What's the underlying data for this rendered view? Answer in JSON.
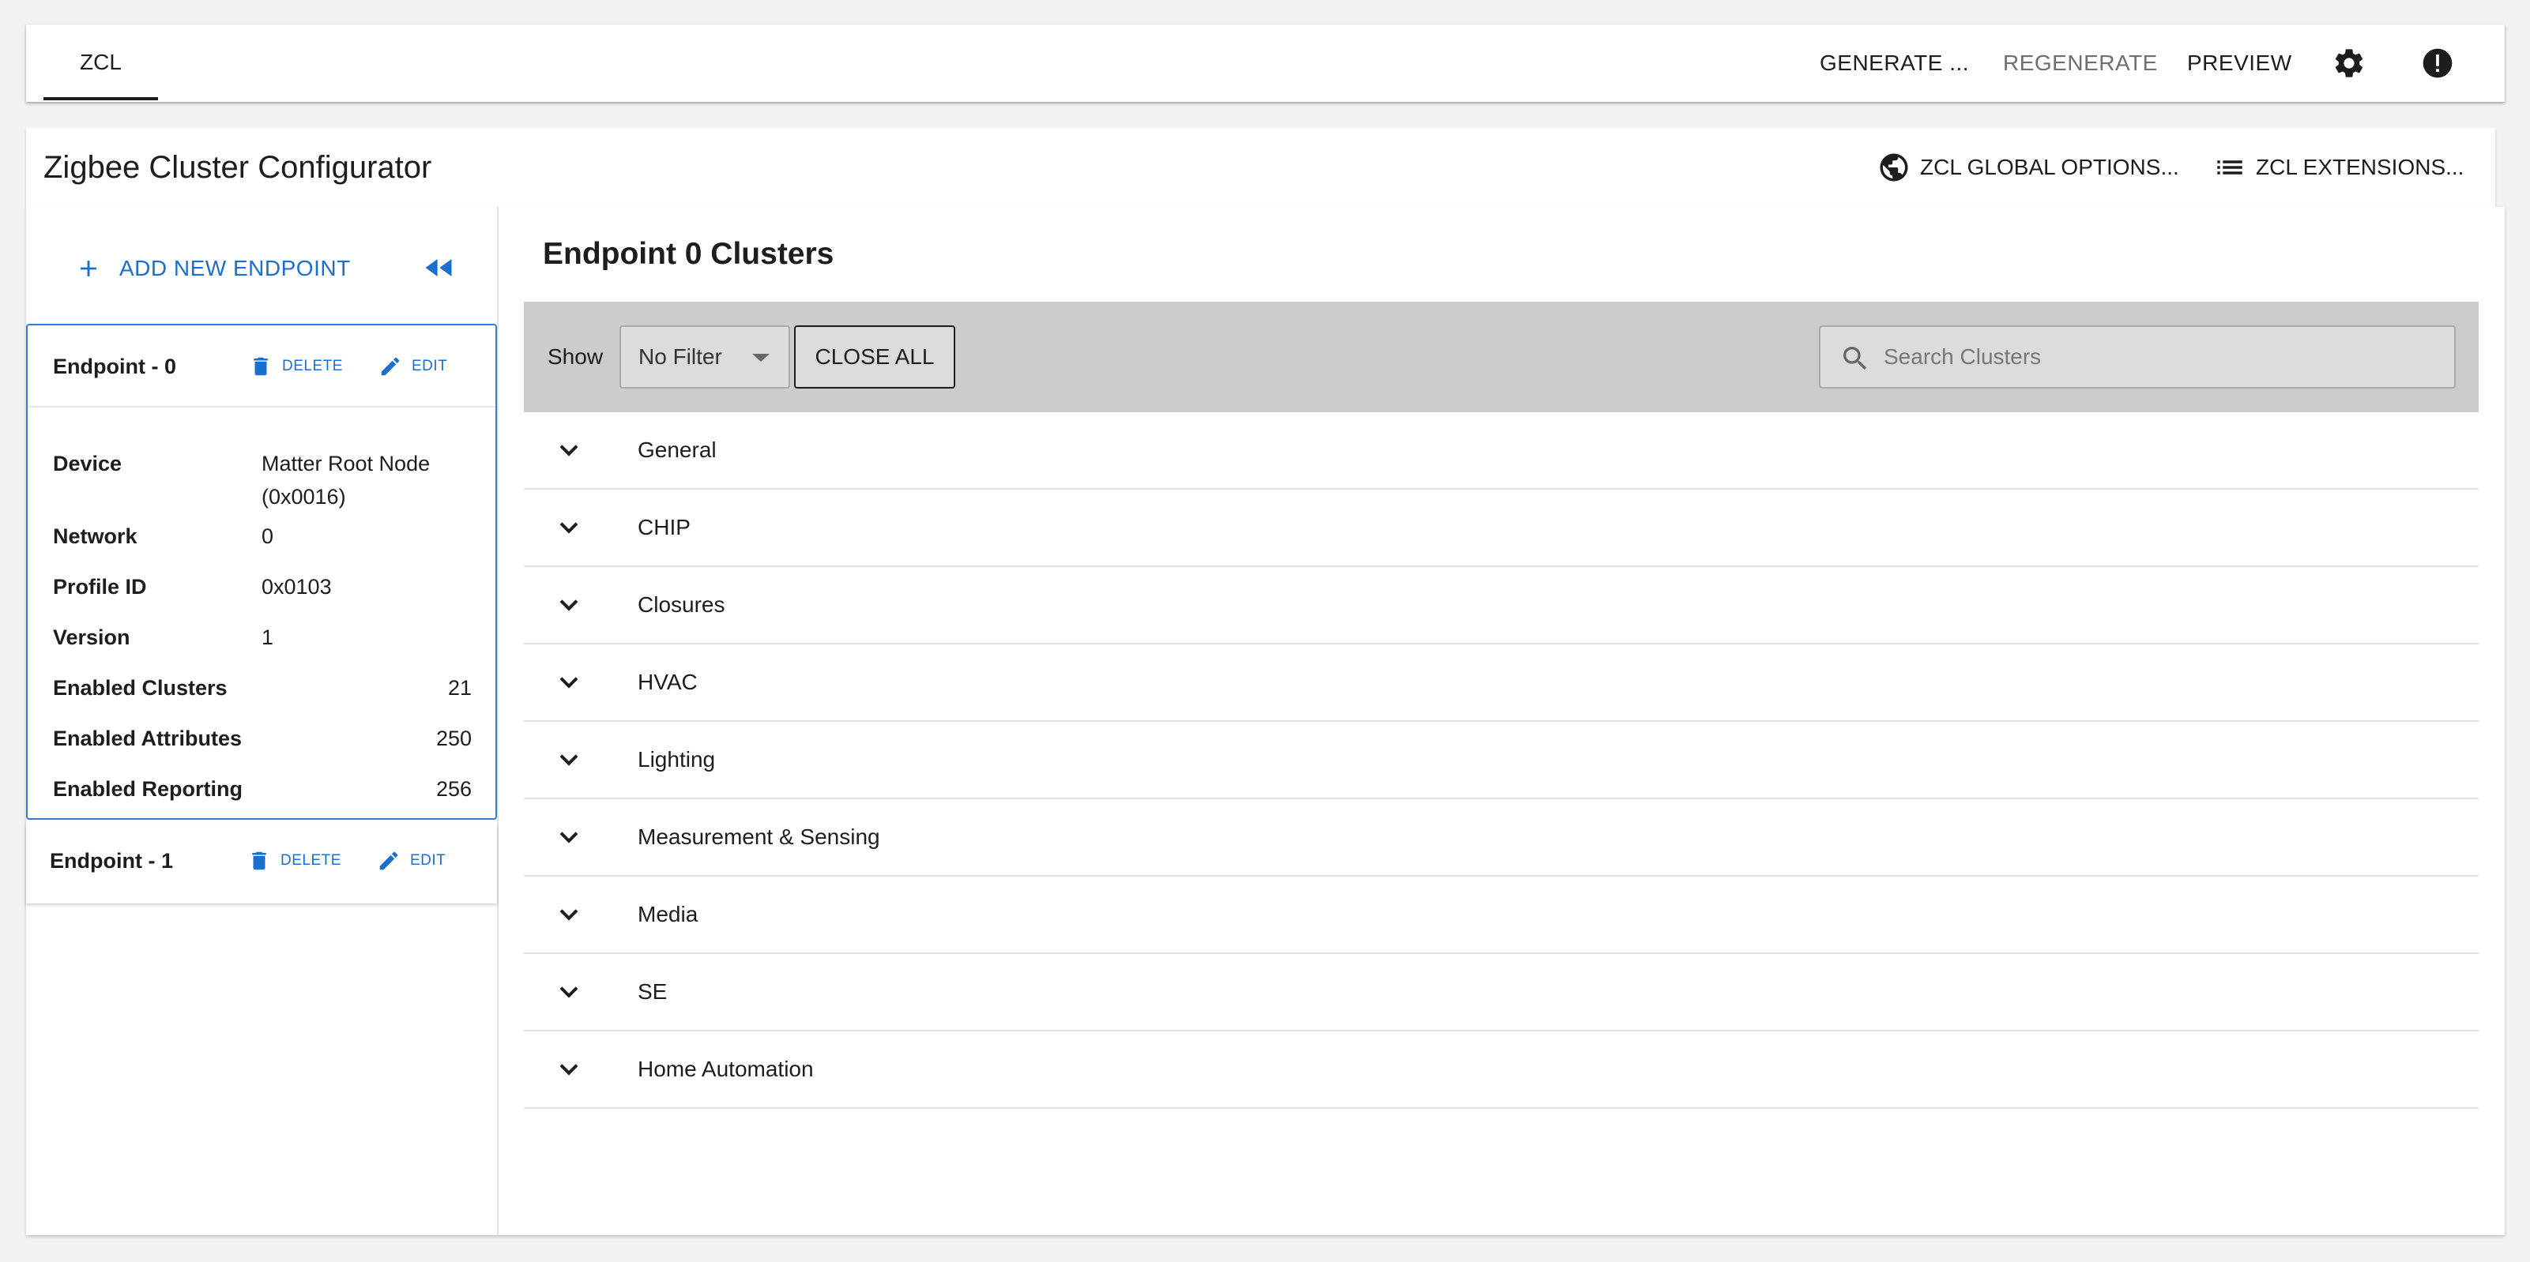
{
  "toolbar": {
    "tab_label": "ZCL",
    "generate_label": "GENERATE ...",
    "regenerate_label": "REGENERATE",
    "preview_label": "PREVIEW"
  },
  "header": {
    "title": "Zigbee Cluster Configurator",
    "global_options_label": "ZCL GLOBAL OPTIONS...",
    "extensions_label": "ZCL EXTENSIONS..."
  },
  "sidebar": {
    "add_endpoint_label": "ADD NEW ENDPOINT",
    "endpoints": [
      {
        "name": "Endpoint - 0",
        "delete_label": "DELETE",
        "edit_label": "EDIT",
        "device_label": "Device",
        "device_value_line1": "Matter Root Node",
        "device_value_line2": "(0x0016)",
        "network_label": "Network",
        "network_value": "0",
        "profile_label": "Profile ID",
        "profile_value": "0x0103",
        "version_label": "Version",
        "version_value": "1",
        "enabled_clusters_label": "Enabled Clusters",
        "enabled_clusters_value": "21",
        "enabled_attributes_label": "Enabled Attributes",
        "enabled_attributes_value": "250",
        "enabled_reporting_label": "Enabled Reporting",
        "enabled_reporting_value": "256"
      },
      {
        "name": "Endpoint - 1",
        "delete_label": "DELETE",
        "edit_label": "EDIT"
      }
    ]
  },
  "content": {
    "title": "Endpoint 0 Clusters",
    "show_label": "Show",
    "filter_value": "No Filter",
    "close_all_label": "CLOSE ALL",
    "search_placeholder": "Search Clusters",
    "categories": [
      "General",
      "CHIP",
      "Closures",
      "HVAC",
      "Lighting",
      "Measurement & Sensing",
      "Media",
      "SE",
      "Home Automation"
    ]
  },
  "colors": {
    "accent": "#1a6fd0",
    "selected_border": "#2f7ed8",
    "filterbar_bg": "#cccccc"
  }
}
